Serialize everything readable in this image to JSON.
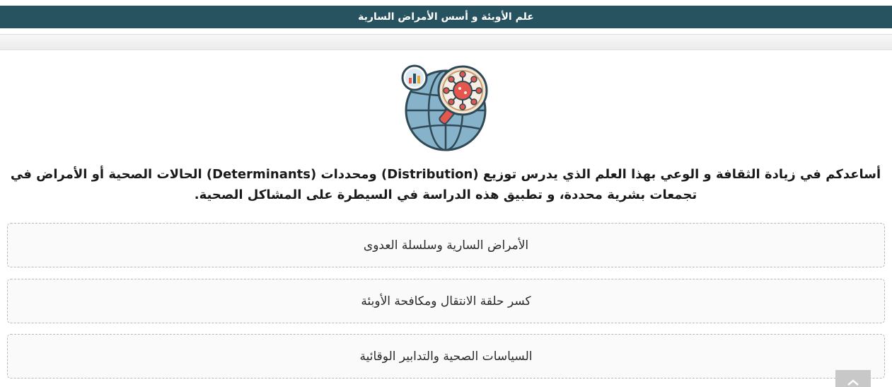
{
  "header": {
    "title": "علم الأوبئة و أسس الأمراض السارية"
  },
  "illustration": {
    "icon": "globe-virus-magnifier-chart-icon"
  },
  "intro": {
    "text": "أساعدكم في زيادة الثقافة و الوعي بهذا العلم الذي يدرس توزيع (Distribution) ومحددات (Determinants) الحالات الصحية أو الأمراض في تجمعات بشرية محددة، و تطبيق هذه الدراسة في السيطرة على المشاكل الصحية."
  },
  "sections": [
    {
      "label": "الأمراض السارية وسلسلة العدوى"
    },
    {
      "label": "كسر حلقة الانتقال ومكافحة الأوبئة"
    },
    {
      "label": "السياسات الصحية والتدابير الوقائية"
    }
  ],
  "scroll_top": {
    "icon": "chevron-up-icon"
  },
  "colors": {
    "header_bg": "#275360",
    "header_text": "#ffffff",
    "globe_fill": "#86b3c9",
    "globe_stroke": "#2f4a56",
    "virus_red": "#e5564e"
  }
}
